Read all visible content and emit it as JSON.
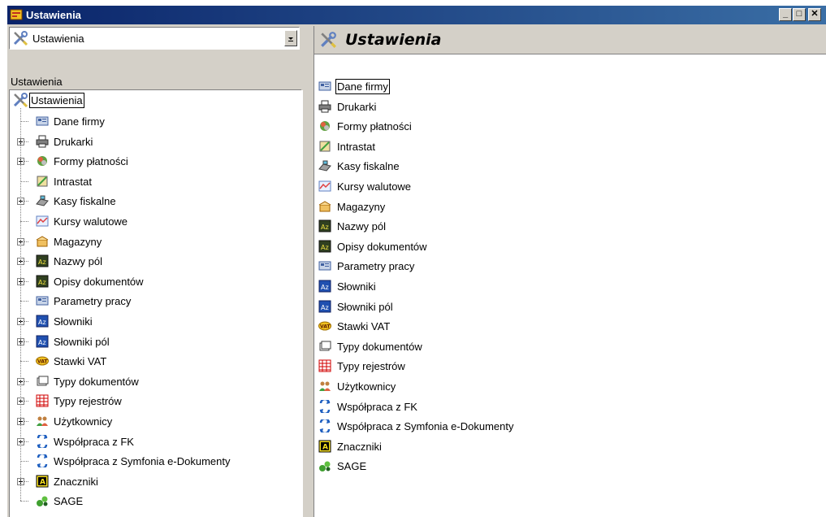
{
  "window": {
    "title": "Ustawienia",
    "controls": [
      "_",
      "□",
      "✕"
    ]
  },
  "combo": {
    "value": "Ustawienia"
  },
  "tree_header": "Ustawienia",
  "tree": {
    "root": "Ustawienia",
    "items": [
      {
        "label": "Dane firmy",
        "icon": "company-data-icon",
        "expandable": false
      },
      {
        "label": "Drukarki",
        "icon": "printer-icon",
        "expandable": true
      },
      {
        "label": "Formy płatności",
        "icon": "payment-forms-icon",
        "expandable": true
      },
      {
        "label": "Intrastat",
        "icon": "intrastat-icon",
        "expandable": false
      },
      {
        "label": "Kasy fiskalne",
        "icon": "cash-register-icon",
        "expandable": true
      },
      {
        "label": "Kursy walutowe",
        "icon": "exchange-rates-icon",
        "expandable": false
      },
      {
        "label": "Magazyny",
        "icon": "warehouse-icon",
        "expandable": true
      },
      {
        "label": "Nazwy pól",
        "icon": "az-dark-icon",
        "expandable": true
      },
      {
        "label": "Opisy dokumentów",
        "icon": "az-dark-icon",
        "expandable": true
      },
      {
        "label": "Parametry pracy",
        "icon": "work-parameters-icon",
        "expandable": false
      },
      {
        "label": "Słowniki",
        "icon": "az-blue-icon",
        "expandable": true
      },
      {
        "label": "Słowniki pól",
        "icon": "az-blue-icon",
        "expandable": true
      },
      {
        "label": "Stawki VAT",
        "icon": "vat-icon",
        "expandable": false
      },
      {
        "label": "Typy dokumentów",
        "icon": "document-types-icon",
        "expandable": true
      },
      {
        "label": "Typy rejestrów",
        "icon": "register-types-icon",
        "expandable": true
      },
      {
        "label": "Użytkownicy",
        "icon": "users-icon",
        "expandable": true
      },
      {
        "label": "Współpraca z FK",
        "icon": "fk-sync-icon",
        "expandable": true
      },
      {
        "label": "Współpraca z Symfonia e-Dokumenty",
        "icon": "fk-sync-icon",
        "expandable": false
      },
      {
        "label": "Znaczniki",
        "icon": "tag-a-icon",
        "expandable": true
      },
      {
        "label": "SAGE",
        "icon": "sage-icon",
        "expandable": false
      }
    ]
  },
  "detail": {
    "title": "Ustawienia",
    "items": [
      {
        "label": "Dane firmy",
        "icon": "company-data-icon"
      },
      {
        "label": "Drukarki",
        "icon": "printer-icon"
      },
      {
        "label": "Formy płatności",
        "icon": "payment-forms-icon"
      },
      {
        "label": "Intrastat",
        "icon": "intrastat-icon"
      },
      {
        "label": "Kasy fiskalne",
        "icon": "cash-register-icon"
      },
      {
        "label": "Kursy walutowe",
        "icon": "exchange-rates-icon"
      },
      {
        "label": "Magazyny",
        "icon": "warehouse-icon"
      },
      {
        "label": "Nazwy pól",
        "icon": "az-dark-icon"
      },
      {
        "label": "Opisy dokumentów",
        "icon": "az-dark-icon"
      },
      {
        "label": "Parametry pracy",
        "icon": "work-parameters-icon"
      },
      {
        "label": "Słowniki",
        "icon": "az-blue-icon"
      },
      {
        "label": "Słowniki pól",
        "icon": "az-blue-icon"
      },
      {
        "label": "Stawki VAT",
        "icon": "vat-icon"
      },
      {
        "label": "Typy dokumentów",
        "icon": "document-types-icon"
      },
      {
        "label": "Typy rejestrów",
        "icon": "register-types-icon"
      },
      {
        "label": "Użytkownicy",
        "icon": "users-icon"
      },
      {
        "label": "Współpraca z FK",
        "icon": "fk-sync-icon"
      },
      {
        "label": "Współpraca z Symfonia e-Dokumenty",
        "icon": "fk-sync-icon"
      },
      {
        "label": "Znaczniki",
        "icon": "tag-a-icon"
      },
      {
        "label": "SAGE",
        "icon": "sage-icon"
      }
    ]
  }
}
